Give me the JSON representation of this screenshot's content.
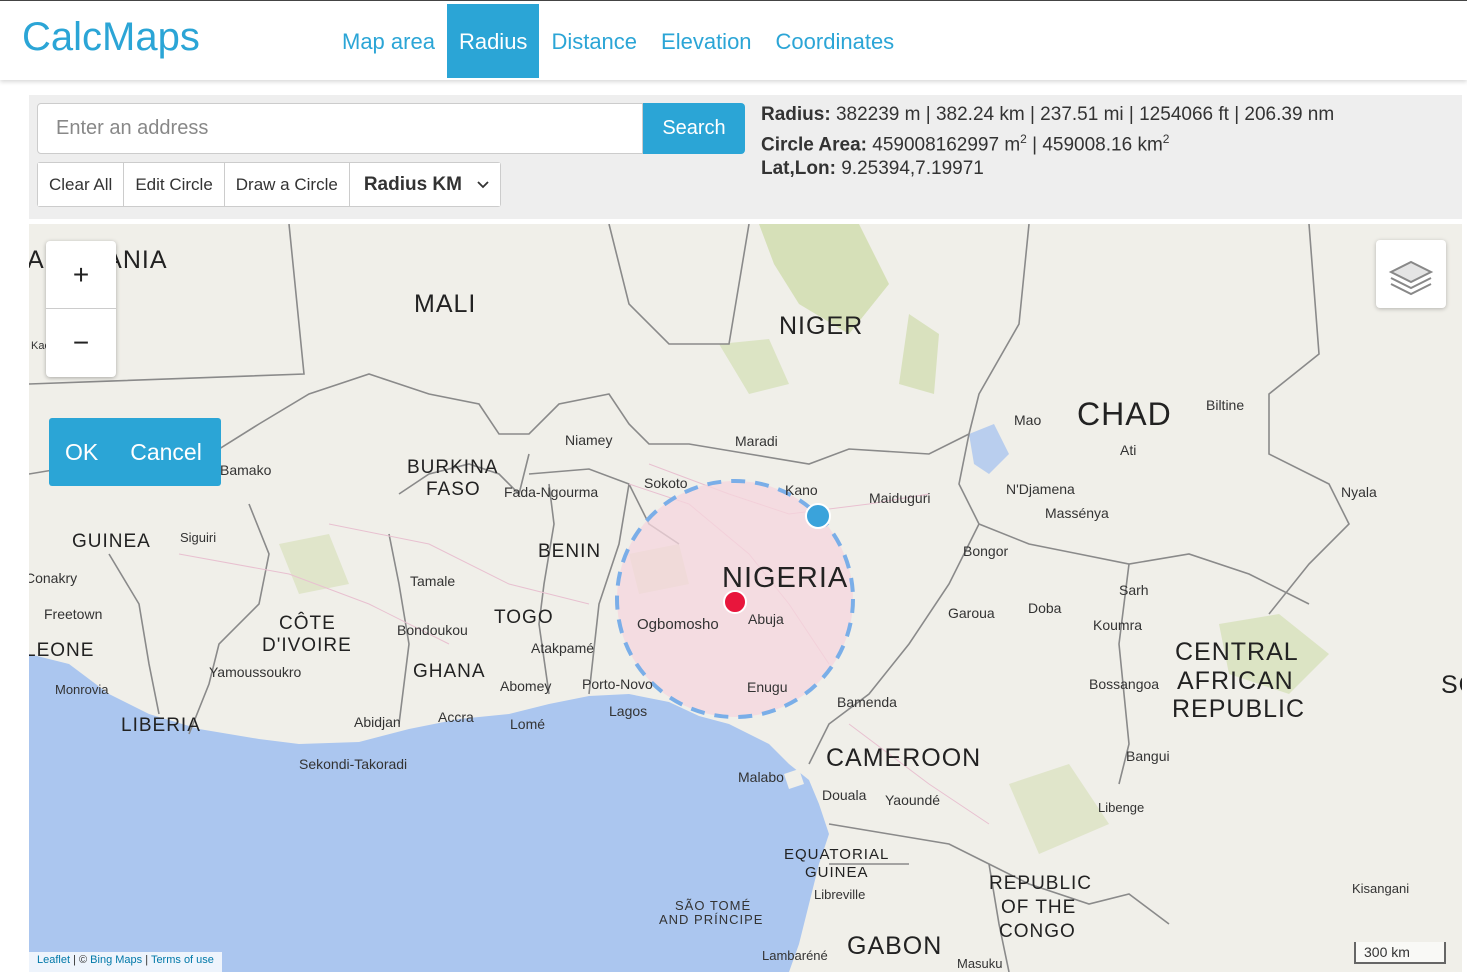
{
  "header": {
    "logo": "CalcMaps",
    "nav": [
      "Map area",
      "Radius",
      "Distance",
      "Elevation",
      "Coordinates"
    ],
    "active_tab": "Radius"
  },
  "toolbar": {
    "search_placeholder": "Enter an address",
    "search_label": "Search",
    "clear_all": "Clear All",
    "edit_circle": "Edit Circle",
    "draw_circle": "Draw a Circle",
    "unit_select": "Radius KM"
  },
  "info": {
    "radius_label": "Radius:",
    "radius_value": "382239 m | 382.24 km | 237.51 mi | 1254066 ft | 206.39 nm",
    "area_label": "Circle Area:",
    "area_m2": "459008162997 m",
    "area_sep": " | 459008.16 km",
    "sup": "2",
    "latlon_label": "Lat,Lon:",
    "latlon_value": "9.25394,7.19971"
  },
  "map": {
    "zoom_in": "+",
    "zoom_out": "−",
    "ok": "OK",
    "cancel": "Cancel",
    "attribution_leaflet": "Leaflet",
    "attribution_bing": "Bing Maps",
    "attribution_terms": "Terms of use",
    "attribution_sep1": " | © ",
    "attribution_sep2": " | ",
    "scale": "300 km",
    "countries": {
      "mauritania": "AURITANIA",
      "mali": "MALI",
      "niger": "NIGER",
      "chad": "CHAD",
      "burkina": "BURKINA",
      "faso": "FASO",
      "guinea": "GUINEA",
      "benin": "BENIN",
      "nigeria": "NIGERIA",
      "togo": "TOGO",
      "cote": "CÔTE",
      "divoire": "D'IVOIRE",
      "ghana": "GHANA",
      "leone": "LEONE",
      "liberia": "LIBERIA",
      "car1": "CENTRAL",
      "car2": "AFRICAN",
      "car3": "REPUBLIC",
      "cameroon": "CAMEROON",
      "eqg1": "EQUATORIAL",
      "eqg2": "GUINEA",
      "roc1": "REPUBLIC",
      "roc2": "OF THE",
      "roc3": "CONGO",
      "gabon": "GABON",
      "stp1": "SÃO TOMÉ",
      "stp2": "AND PRÍNCIPE",
      "so": "SO"
    },
    "cities": {
      "kaedi": "Kaédi",
      "bamako": "Bamako",
      "niamey": "Niamey",
      "maradi": "Maradi",
      "mao": "Mao",
      "biltine": "Biltine",
      "ati": "Ati",
      "sokoto": "Sokoto",
      "kano": "Kano",
      "maiduguri": "Maiduguri",
      "ndjamena": "N'Djamena",
      "massenya": "Massénya",
      "nyala": "Nyala",
      "fada": "Fada-Ngourma",
      "siguiri": "Siguiri",
      "conakry": "Conakry",
      "freetown": "Freetown",
      "bongor": "Bongor",
      "tamale": "Tamale",
      "sarh": "Sarh",
      "garoua": "Garoua",
      "doba": "Doba",
      "koumra": "Koumra",
      "bondoukou": "Bondoukou",
      "atakpame": "Atakpamé",
      "ogbomosho": "Ogbomosho",
      "abuja": "Abuja",
      "yamoussoukro": "Yamoussoukro",
      "monrovia": "Monrovia",
      "abomey": "Abomey",
      "portonovo": "Porto-Novo",
      "enugu": "Enugu",
      "bossangoa": "Bossangoa",
      "lagos": "Lagos",
      "bamenda": "Bamenda",
      "abidjan": "Abidjan",
      "accra": "Accra",
      "lome": "Lomé",
      "bangui": "Bangui",
      "sekondi": "Sekondi-Takoradi",
      "malabo": "Malabo",
      "douala": "Douala",
      "yaounde": "Yaoundé",
      "libenge": "Libenge",
      "libreville": "Libreville",
      "kisangani": "Kisangani",
      "lambarene": "Lambaréné",
      "masuku": "Masuku"
    }
  },
  "colors": {
    "accent": "#2ba5d6",
    "circle_fill": "#f6d6dd",
    "circle_stroke": "#7aaee8",
    "center_marker": "#e8163c",
    "edge_marker": "#3aa3db",
    "water": "#abc6ef",
    "land": "#f0efe9",
    "green": "#cfdcab"
  }
}
